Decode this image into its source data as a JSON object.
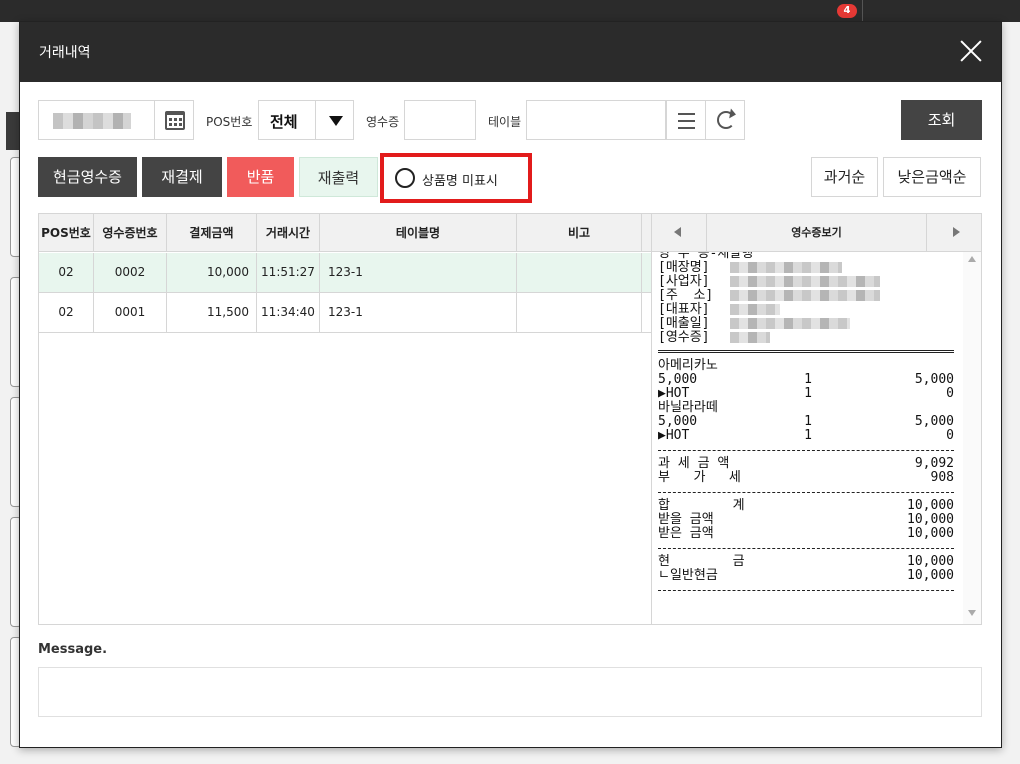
{
  "background": {
    "notification_count": "4"
  },
  "dialog": {
    "title": "거래내역"
  },
  "filters": {
    "pos_label": "POS번호",
    "pos_value": "전체",
    "receipt_label": "영수증",
    "receipt_value": "",
    "table_label": "테이블",
    "table_value": "",
    "search_label": "조회"
  },
  "actions": {
    "cash_receipt": "현금영수증",
    "repay": "재결제",
    "refund": "반품",
    "reprint": "재출력",
    "hide_product_name": "상품명 미표시",
    "sort_oldest": "과거순",
    "sort_lowest_amount": "낮은금액순"
  },
  "table": {
    "columns": [
      "POS번호",
      "영수증번호",
      "결제금액",
      "거래시간",
      "테이블명",
      "비고"
    ],
    "rows": [
      {
        "pos": "02",
        "receipt": "0002",
        "amount": "10,000",
        "time": "11:51:27",
        "table": "123-1",
        "note": ""
      },
      {
        "pos": "02",
        "receipt": "0001",
        "amount": "11,500",
        "time": "11:34:40",
        "table": "123-1",
        "note": ""
      }
    ]
  },
  "receipt": {
    "title": "영수증보기",
    "heading": "영 수 증-재발행",
    "info_labels": [
      "[매장명]",
      "[사업자]",
      "[주  소]",
      "[대표자]",
      "[매출일]",
      "[영수증]"
    ],
    "items": [
      {
        "name": "아메리카노",
        "price": "5,000",
        "qty": "1",
        "total": "5,000"
      },
      {
        "name": "▶HOT",
        "price": "",
        "qty": "1",
        "total": "0"
      },
      {
        "name": "바닐라라떼",
        "price": "5,000",
        "qty": "1",
        "total": "5,000"
      },
      {
        "name": "▶HOT",
        "price": "",
        "qty": "1",
        "total": "0"
      }
    ],
    "tax": [
      {
        "label": "과 세 금 액",
        "value": "9,092"
      },
      {
        "label": "부   가   세",
        "value": "908"
      }
    ],
    "totals": [
      {
        "label": "합        계",
        "value": "10,000"
      },
      {
        "label": "받을 금액",
        "value": "10,000"
      },
      {
        "label": "받은 금액",
        "value": "10,000"
      }
    ],
    "payments": [
      {
        "label": "현        금",
        "value": "10,000"
      },
      {
        "label": "ㄴ일반현금",
        "value": "10,000"
      }
    ]
  },
  "message": {
    "label": "Message.",
    "text": ""
  }
}
